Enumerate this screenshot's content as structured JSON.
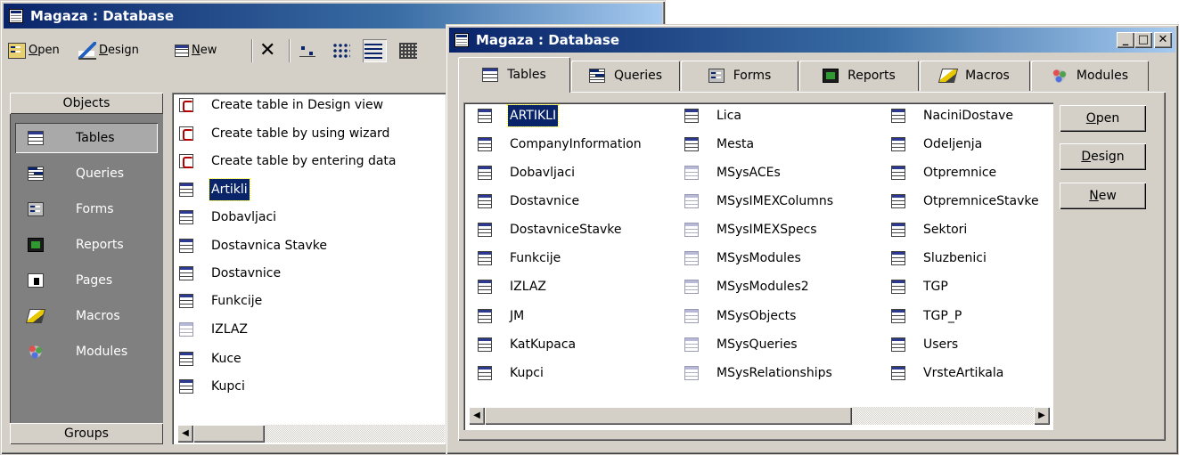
{
  "back_window": {
    "title": "Magaza : Database",
    "toolbar": {
      "open": "Open",
      "open_u": "O",
      "design": "Design",
      "design_u": "D",
      "new": "New",
      "new_u": "N"
    },
    "objects_header": "Objects",
    "groups_header": "Groups",
    "objects": [
      {
        "label": "Tables",
        "icon": "table-icon"
      },
      {
        "label": "Queries",
        "icon": "query-icon"
      },
      {
        "label": "Forms",
        "icon": "form-icon"
      },
      {
        "label": "Reports",
        "icon": "report-icon"
      },
      {
        "label": "Pages",
        "icon": "page-icon"
      },
      {
        "label": "Macros",
        "icon": "macro-icon"
      },
      {
        "label": "Modules",
        "icon": "module-icon"
      }
    ],
    "items": [
      {
        "label": "Create table in Design view",
        "kind": "wizard"
      },
      {
        "label": "Create table by using wizard",
        "kind": "wizard"
      },
      {
        "label": "Create table by entering data",
        "kind": "wizard"
      },
      {
        "label": "Artikli",
        "kind": "table"
      },
      {
        "label": "Dobavljaci",
        "kind": "table"
      },
      {
        "label": "Dostavnica Stavke",
        "kind": "table"
      },
      {
        "label": "Dostavnice",
        "kind": "table"
      },
      {
        "label": "Funkcije",
        "kind": "table"
      },
      {
        "label": "IZLAZ",
        "kind": "table-linked"
      },
      {
        "label": "Kuce",
        "kind": "table"
      },
      {
        "label": "Kupci",
        "kind": "table"
      }
    ]
  },
  "front_window": {
    "title": "Magaza : Database",
    "caption_buttons": {
      "minimize": "_",
      "maximize": "□",
      "close": "✕"
    },
    "tabs": [
      "Tables",
      "Queries",
      "Forms",
      "Reports",
      "Macros",
      "Modules"
    ],
    "columns": [
      [
        "ARTIKLI",
        "CompanyInformation",
        "Dobavljaci",
        "Dostavnice",
        "DostavniceStavke",
        "Funkcije",
        "IZLAZ",
        "JM",
        "KatKupaca",
        "Kupci"
      ],
      [
        "Lica",
        "Mesta",
        "MSysACEs",
        "MSysIMEXColumns",
        "MSysIMEXSpecs",
        "MSysModules",
        "MSysModules2",
        "MSysObjects",
        "MSysQueries",
        "MSysRelationships"
      ],
      [
        "NaciniDostave",
        "Odeljenja",
        "Otpremnice",
        "OtpremniceStavke",
        "Sektori",
        "Sluzbenici",
        "TGP",
        "TGP_P",
        "Users",
        "VrsteArtikala"
      ]
    ],
    "system_flags": [
      [
        false,
        false,
        false,
        false,
        false,
        false,
        false,
        false,
        false,
        false
      ],
      [
        false,
        false,
        true,
        true,
        true,
        true,
        true,
        true,
        true,
        true
      ],
      [
        false,
        false,
        false,
        false,
        false,
        false,
        false,
        false,
        false,
        false
      ]
    ],
    "buttons": {
      "open": "Open",
      "open_u": "O",
      "design": "Design",
      "design_u": "D",
      "new": "New",
      "new_u": "N"
    }
  }
}
